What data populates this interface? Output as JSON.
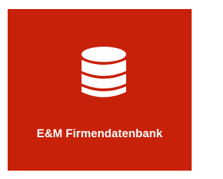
{
  "tile": {
    "label": "E&M Firmendatenbank",
    "icon": "database-icon",
    "background_color": "#c8210a",
    "icon_color": "#ffffff",
    "text_color": "#ffffff"
  }
}
